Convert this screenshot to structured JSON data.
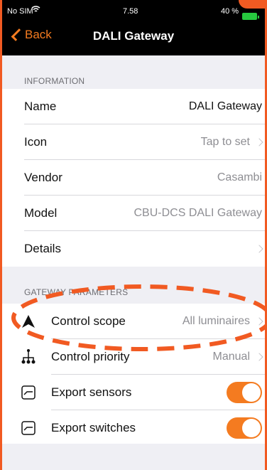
{
  "status": {
    "carrier": "No SIM",
    "time": "7.58",
    "battery": "40 %"
  },
  "nav": {
    "back_label": "Back",
    "title": "DALI Gateway"
  },
  "information": {
    "title": "INFORMATION",
    "rows": [
      {
        "label": "Name",
        "value": "DALI Gateway"
      },
      {
        "label": "Icon",
        "value": "Tap to set"
      },
      {
        "label": "Vendor",
        "value": "Casambi"
      },
      {
        "label": "Model",
        "value": "CBU-DCS DALI Gateway"
      },
      {
        "label": "Details",
        "value": ""
      }
    ]
  },
  "gateway": {
    "title": "GATEWAY PARAMETERS",
    "rows": [
      {
        "label": "Control scope",
        "value": "All luminaires",
        "icon": "triangle-icon"
      },
      {
        "label": "Control priority",
        "value": "Manual",
        "icon": "network-icon"
      },
      {
        "label": "Export sensors",
        "toggle": true,
        "icon": "sensor-icon"
      },
      {
        "label": "Export switches",
        "toggle": true,
        "icon": "switch-icon"
      }
    ]
  },
  "colors": {
    "accent": "#f47b20",
    "annotation": "#f15a22"
  }
}
